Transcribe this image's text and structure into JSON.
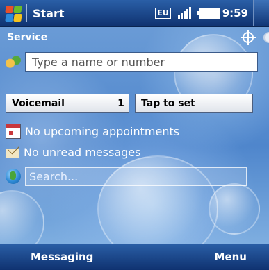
{
  "topbar": {
    "start_label": "Start",
    "network_badge": "EU",
    "time": "9:59"
  },
  "today": {
    "service_label": "Service",
    "call_input_placeholder": "Type a name or number",
    "speed_dial": [
      {
        "label": "Voicemail",
        "count": "1"
      },
      {
        "label": "Tap to set",
        "count": ""
      }
    ],
    "appointments_text": "No upcoming appointments",
    "messages_text": "No unread messages",
    "search_placeholder": "Search..."
  },
  "softkeys": {
    "left": "Messaging",
    "right": "Menu"
  },
  "colors": {
    "bar_top": "#2a5fa7",
    "bar_bottom": "#0f3270",
    "background": "#5b8fd2"
  }
}
